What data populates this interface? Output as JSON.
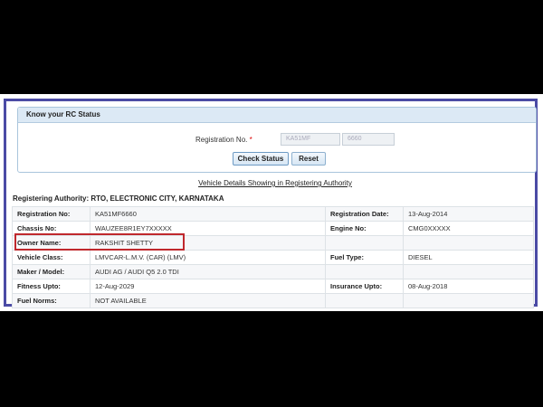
{
  "panel": {
    "title": "Know your RC Status",
    "registration_label": "Registration No.",
    "required_mark": "*",
    "reg_part1": "KA51MF",
    "reg_part2": "6660",
    "check_button": "Check Status",
    "reset_button": "Reset"
  },
  "caption": "Vehicle Details Showing in Registering Authority",
  "authority": "Registering Authority: RTO, ELECTRONIC CITY, KARNATAKA",
  "rows": [
    {
      "l1": "Registration No:",
      "v1": "KA51MF6660",
      "l2": "Registration Date:",
      "v2": "13-Aug-2014"
    },
    {
      "l1": "Chassis No:",
      "v1": "WAUZEE8R1EY7XXXXX",
      "l2": "Engine No:",
      "v2": "CMG0XXXXX"
    },
    {
      "l1": "Owner Name:",
      "v1": "RAKSHIT SHETTY",
      "l2": "",
      "v2": ""
    },
    {
      "l1": "Vehicle Class:",
      "v1": "LMVCAR-L.M.V. (CAR) (LMV)",
      "l2": "Fuel Type:",
      "v2": "DIESEL"
    },
    {
      "l1": "Maker / Model:",
      "v1": "AUDI AG / AUDI Q5 2.0 TDI",
      "l2": "",
      "v2": ""
    },
    {
      "l1": "Fitness Upto:",
      "v1": "12-Aug-2029",
      "l2": "Insurance Upto:",
      "v2": "08-Aug-2018"
    },
    {
      "l1": "Fuel Norms:",
      "v1": "NOT AVAILABLE",
      "l2": "",
      "v2": ""
    }
  ],
  "colors": {
    "highlight": "#c0282d",
    "frame": "#4b4ba5",
    "panel_header": "#dce9f5"
  }
}
